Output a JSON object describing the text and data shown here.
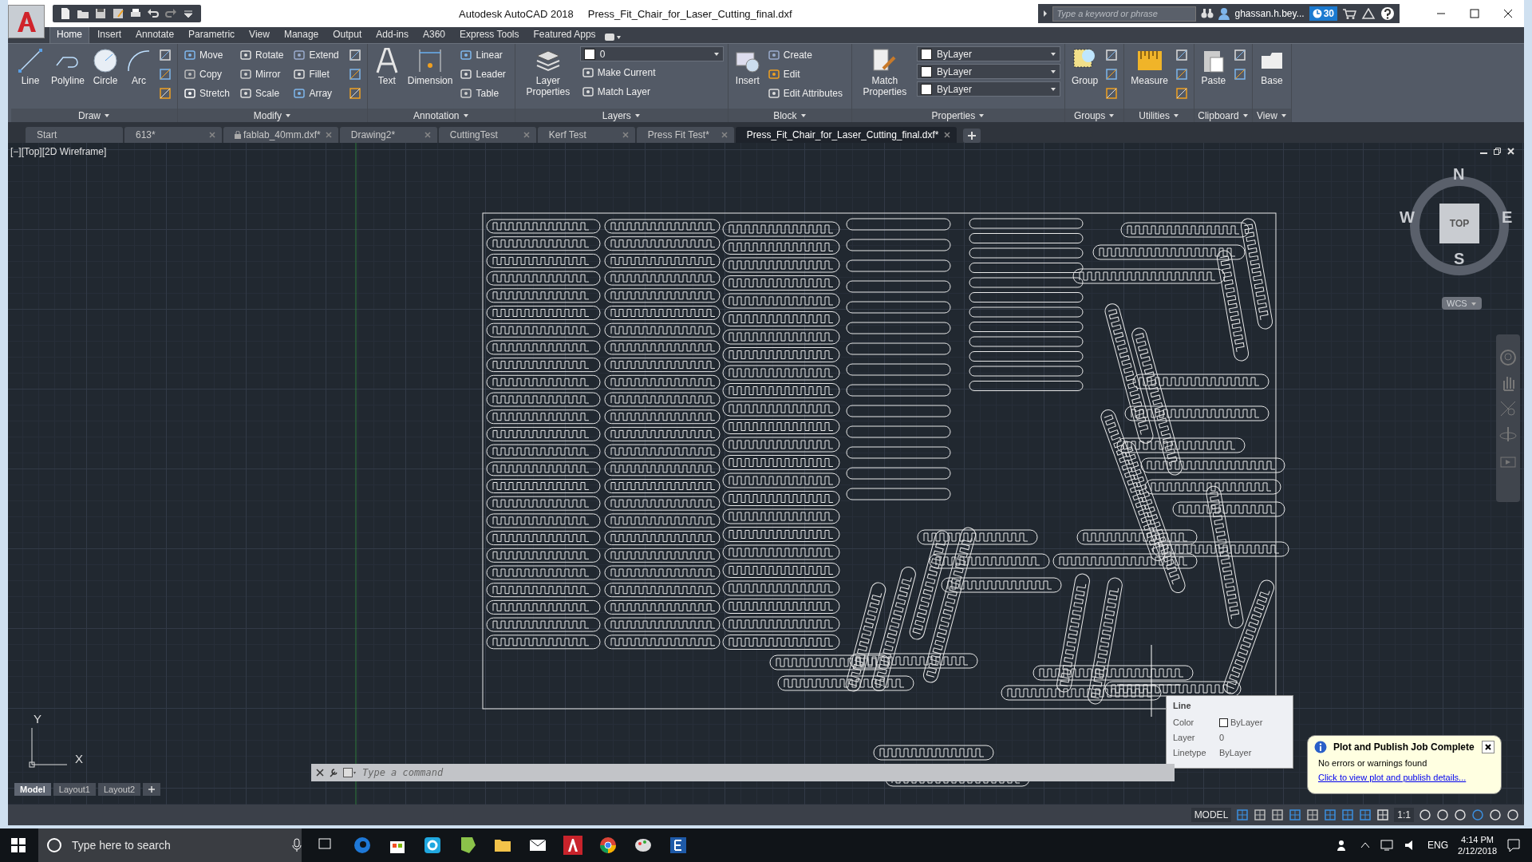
{
  "title_bar": {
    "app_name": "Autodesk AutoCAD 2018",
    "file_name": "Press_Fit_Chair_for_Laser_Cutting_final.dxf",
    "search": {
      "placeholder": "Type a keyword or phrase"
    },
    "user": "ghassan.h.bey...",
    "trial_days": "30"
  },
  "ribbon_tabs": [
    {
      "label": "Home",
      "selected": true
    },
    {
      "label": "Insert",
      "selected": false
    },
    {
      "label": "Annotate",
      "selected": false
    },
    {
      "label": "Parametric",
      "selected": false
    },
    {
      "label": "View",
      "selected": false
    },
    {
      "label": "Manage",
      "selected": false
    },
    {
      "label": "Output",
      "selected": false
    },
    {
      "label": "Add-ins",
      "selected": false
    },
    {
      "label": "A360",
      "selected": false
    },
    {
      "label": "Express Tools",
      "selected": false
    },
    {
      "label": "Featured Apps",
      "selected": false
    }
  ],
  "ribbon_panels": [
    {
      "title": "Draw",
      "items": [
        {
          "kind": "large",
          "label": "Line"
        },
        {
          "kind": "large",
          "label": "Polyline"
        },
        {
          "kind": "large",
          "label": "Circle"
        },
        {
          "kind": "large",
          "label": "Arc"
        },
        {
          "kind": "icon"
        },
        {
          "kind": "icon"
        },
        {
          "kind": "icon"
        }
      ]
    },
    {
      "title": "Modify",
      "items": [
        {
          "kind": "small",
          "label": "Move"
        },
        {
          "kind": "small",
          "label": "Copy"
        },
        {
          "kind": "small",
          "label": "Stretch"
        },
        {
          "kind": "small",
          "label": "Rotate"
        },
        {
          "kind": "small",
          "label": "Mirror"
        },
        {
          "kind": "small",
          "label": "Scale"
        },
        {
          "kind": "small",
          "label": "Extend"
        },
        {
          "kind": "small",
          "label": "Fillet"
        },
        {
          "kind": "small",
          "label": "Array"
        },
        {
          "kind": "icon"
        },
        {
          "kind": "icon"
        },
        {
          "kind": "icon"
        }
      ]
    },
    {
      "title": "Annotation",
      "items": [
        {
          "kind": "large",
          "label": "Text"
        },
        {
          "kind": "large",
          "label": "Dimension"
        },
        {
          "kind": "small",
          "label": "Linear"
        },
        {
          "kind": "small",
          "label": "Leader"
        },
        {
          "kind": "small",
          "label": "Table"
        }
      ]
    },
    {
      "title": "Layers",
      "items": [
        {
          "kind": "large",
          "label": "Layer Properties"
        },
        {
          "kind": "dropdown",
          "label": "0"
        },
        {
          "kind": "small",
          "label": "Make Current"
        },
        {
          "kind": "small",
          "label": "Match Layer"
        }
      ]
    },
    {
      "title": "Block",
      "items": [
        {
          "kind": "large",
          "label": "Insert"
        },
        {
          "kind": "small",
          "label": "Create"
        },
        {
          "kind": "small",
          "label": "Edit"
        },
        {
          "kind": "small",
          "label": "Edit Attributes"
        }
      ]
    },
    {
      "title": "Properties",
      "items": [
        {
          "kind": "large",
          "label": "Match Properties"
        },
        {
          "kind": "dropdown",
          "label": "ByLayer"
        },
        {
          "kind": "dropdown",
          "label": "ByLayer"
        },
        {
          "kind": "dropdown",
          "label": "ByLayer"
        }
      ]
    },
    {
      "title": "Groups",
      "items": [
        {
          "kind": "large",
          "label": "Group"
        },
        {
          "kind": "icon"
        },
        {
          "kind": "icon"
        },
        {
          "kind": "icon"
        }
      ]
    },
    {
      "title": "Utilities",
      "items": [
        {
          "kind": "large",
          "label": "Measure"
        },
        {
          "kind": "icon"
        },
        {
          "kind": "icon"
        },
        {
          "kind": "icon"
        }
      ]
    },
    {
      "title": "Clipboard",
      "items": [
        {
          "kind": "large",
          "label": "Paste"
        },
        {
          "kind": "icon"
        },
        {
          "kind": "icon"
        }
      ]
    },
    {
      "title": "View",
      "items": [
        {
          "kind": "large",
          "label": "Base"
        }
      ]
    }
  ],
  "file_tabs": [
    {
      "label": "Start",
      "selected": false,
      "locked": false
    },
    {
      "label": "613*",
      "selected": false,
      "locked": false
    },
    {
      "label": "fablab_40mm.dxf*",
      "selected": false,
      "locked": true
    },
    {
      "label": "Drawing2*",
      "selected": false,
      "locked": false
    },
    {
      "label": "CuttingTest",
      "selected": false,
      "locked": false
    },
    {
      "label": "Kerf Test",
      "selected": false,
      "locked": false
    },
    {
      "label": "Press Fit Test*",
      "selected": false,
      "locked": false
    },
    {
      "label": "Press_Fit_Chair_for_Laser_Cutting_final.dxf*",
      "selected": true,
      "locked": false
    }
  ],
  "viewport": {
    "label": "[−][Top][2D Wireframe]",
    "viewcube": {
      "north": "N",
      "south": "S",
      "east": "E",
      "west": "W",
      "face": "TOP",
      "ucs": "WCS"
    },
    "axes": {
      "x": "X",
      "y": "Y"
    },
    "tooltip": {
      "title": "Line",
      "properties": [
        {
          "name": "Color",
          "value": "ByLayer",
          "kind": "swatch"
        },
        {
          "name": "Layer",
          "value": "0",
          "kind": "text"
        },
        {
          "name": "Linetype",
          "value": "ByLayer",
          "kind": "text"
        }
      ]
    }
  },
  "command_line": {
    "placeholder": "Type a command"
  },
  "layout_tabs": [
    {
      "label": "Model",
      "selected": true
    },
    {
      "label": "Layout1",
      "selected": false
    },
    {
      "label": "Layout2",
      "selected": false
    }
  ],
  "status_bar": {
    "space": "MODEL",
    "scale": "1:1"
  },
  "notification": {
    "title": "Plot and Publish Job Complete",
    "message": "No errors or warnings found",
    "link": "Click to view plot and publish details..."
  },
  "taskbar": {
    "search": {
      "placeholder": "Type here to search"
    },
    "language": "ENG",
    "time": "4:14 PM",
    "date": "2/12/2018"
  }
}
